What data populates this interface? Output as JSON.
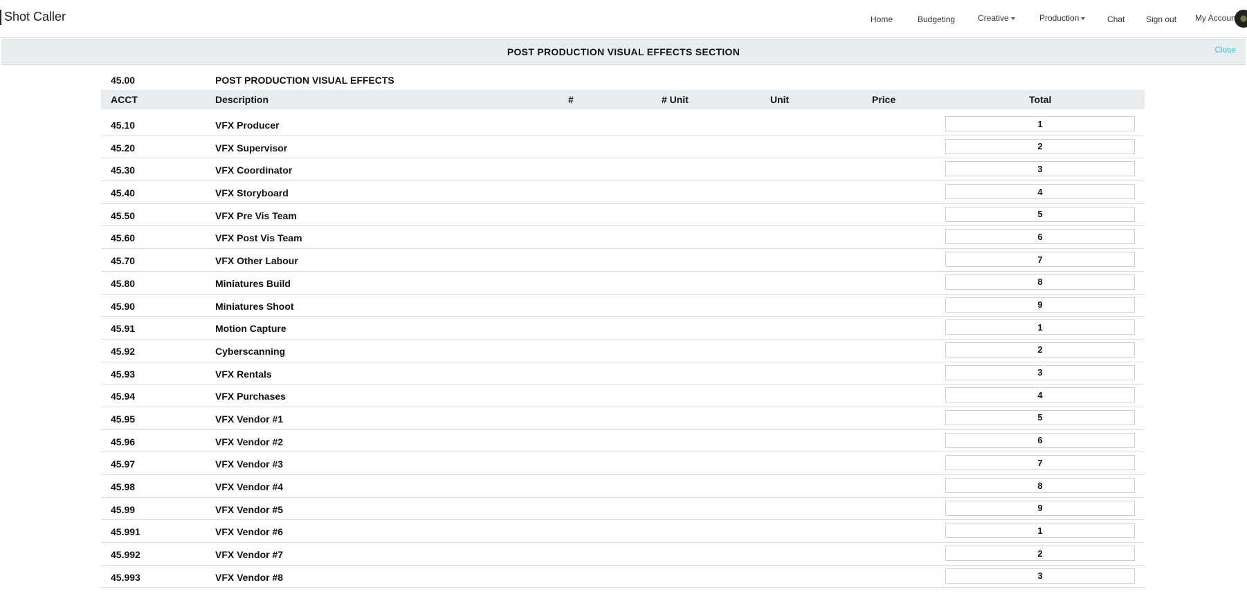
{
  "app": {
    "brand": "Shot Caller"
  },
  "nav": {
    "home": "Home",
    "budgeting": "Budgeting",
    "creative": "Creative",
    "production": "Production",
    "chat": "Chat",
    "sign_out": "Sign out",
    "my_account": "My Account"
  },
  "section": {
    "title": "POST PRODUCTION VISUAL EFFECTS SECTION",
    "close": "Close"
  },
  "group": {
    "acct": "45.00",
    "desc": "POST PRODUCTION VISUAL EFFECTS"
  },
  "columns": {
    "acct": "ACCT",
    "desc": "Description",
    "num": "#",
    "num_unit": "# Unit",
    "unit": "Unit",
    "price": "Price",
    "total": "Total"
  },
  "rows": [
    {
      "acct": "45.10",
      "desc": "VFX Producer",
      "total": "1"
    },
    {
      "acct": "45.20",
      "desc": "VFX Supervisor",
      "total": "2"
    },
    {
      "acct": "45.30",
      "desc": "VFX Coordinator",
      "total": "3"
    },
    {
      "acct": "45.40",
      "desc": "VFX Storyboard",
      "total": "4"
    },
    {
      "acct": "45.50",
      "desc": "VFX Pre Vis Team",
      "total": "5"
    },
    {
      "acct": "45.60",
      "desc": "VFX Post Vis Team",
      "total": "6"
    },
    {
      "acct": "45.70",
      "desc": "VFX Other Labour",
      "total": "7"
    },
    {
      "acct": "45.80",
      "desc": "Miniatures Build",
      "total": "8"
    },
    {
      "acct": "45.90",
      "desc": "Miniatures Shoot",
      "total": "9"
    },
    {
      "acct": "45.91",
      "desc": "Motion Capture",
      "total": "1"
    },
    {
      "acct": "45.92",
      "desc": "Cyberscanning",
      "total": "2"
    },
    {
      "acct": "45.93",
      "desc": "VFX Rentals",
      "total": "3"
    },
    {
      "acct": "45.94",
      "desc": "VFX Purchases",
      "total": "4"
    },
    {
      "acct": "45.95",
      "desc": "VFX Vendor #1",
      "total": "5"
    },
    {
      "acct": "45.96",
      "desc": "VFX Vendor #2",
      "total": "6"
    },
    {
      "acct": "45.97",
      "desc": "VFX Vendor #3",
      "total": "7"
    },
    {
      "acct": "45.98",
      "desc": "VFX Vendor #4",
      "total": "8"
    },
    {
      "acct": "45.99",
      "desc": "VFX Vendor #5",
      "total": "9"
    },
    {
      "acct": "45.991",
      "desc": "VFX Vendor #6",
      "total": "1"
    },
    {
      "acct": "45.992",
      "desc": "VFX Vendor #7",
      "total": "2"
    },
    {
      "acct": "45.993",
      "desc": "VFX Vendor #8",
      "total": "3"
    }
  ]
}
